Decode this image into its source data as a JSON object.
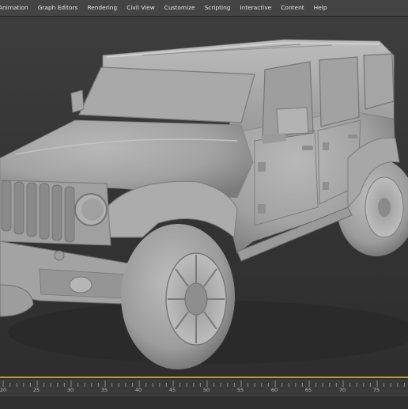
{
  "menu": {
    "items": [
      "Animation",
      "Graph Editors",
      "Rendering",
      "Civil View",
      "Customize",
      "Scripting",
      "Interactive",
      "Content",
      "Help"
    ]
  },
  "viewport": {
    "subject": "3d-jeep-model",
    "background_color": "#383838",
    "model_color": "#a8a8a8"
  },
  "timeline": {
    "accent_color": "#d6a400",
    "tick_labels": [
      "20",
      "25",
      "30",
      "35",
      "40",
      "45",
      "50",
      "55",
      "60",
      "65",
      "70",
      "75"
    ]
  }
}
